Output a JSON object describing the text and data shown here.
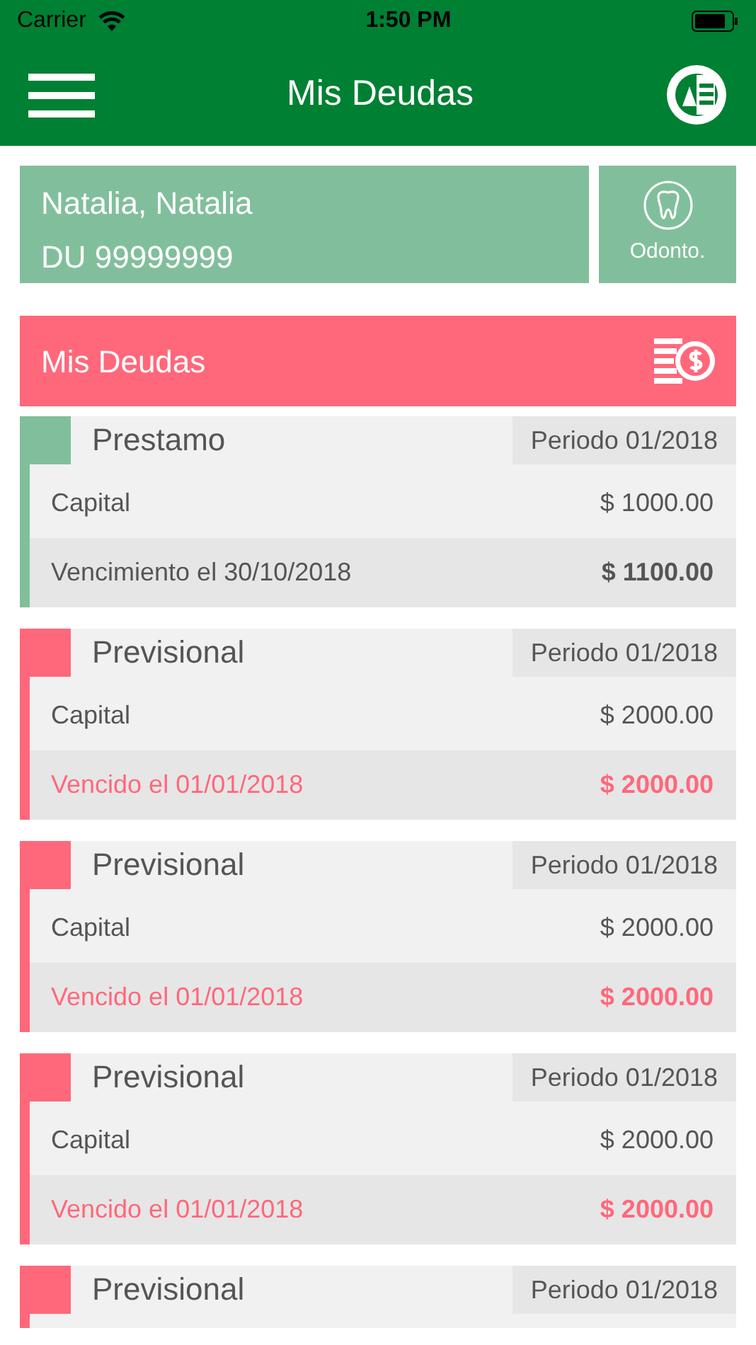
{
  "status_bar": {
    "carrier": "Carrier",
    "time": "1:50 PM"
  },
  "nav": {
    "title": "Mis Deudas"
  },
  "profile": {
    "name": "Natalia, Natalia",
    "document": "DU 99999999",
    "shortcut": "Odonto."
  },
  "section": {
    "title": "Mis Deudas"
  },
  "debts": [
    {
      "type": "Prestamo",
      "period": "Periodo 01/2018",
      "overdue": false,
      "capital_label": "Capital",
      "capital": "$ 1000.00",
      "due_label": "Vencimiento el 30/10/2018",
      "due_amount": "$ 1100.00"
    },
    {
      "type": "Previsional",
      "period": "Periodo 01/2018",
      "overdue": true,
      "capital_label": "Capital",
      "capital": "$ 2000.00",
      "due_label": "Vencido el 01/01/2018",
      "due_amount": "$ 2000.00"
    },
    {
      "type": "Previsional",
      "period": "Periodo 01/2018",
      "overdue": true,
      "capital_label": "Capital",
      "capital": "$ 2000.00",
      "due_label": "Vencido el 01/01/2018",
      "due_amount": "$ 2000.00"
    },
    {
      "type": "Previsional",
      "period": "Periodo 01/2018",
      "overdue": true,
      "capital_label": "Capital",
      "capital": "$ 2000.00",
      "due_label": "Vencido el 01/01/2018",
      "due_amount": "$ 2000.00"
    },
    {
      "type": "Previsional",
      "period": "Periodo 01/2018",
      "overdue": true
    }
  ]
}
